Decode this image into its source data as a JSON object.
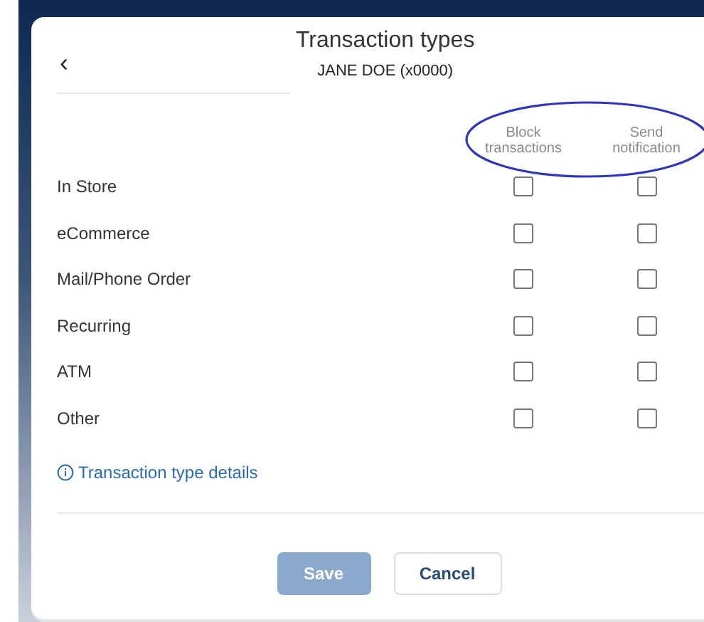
{
  "dialog": {
    "back": "‹",
    "title": "Transaction types",
    "subtitle": "JANE DOE (x0000)"
  },
  "columns": [
    "Block\ntransactions",
    "Send\nnotification"
  ],
  "annotations": [
    {
      "kind": "ellipse"
    }
  ],
  "rows": [
    {
      "label": "In Store",
      "block": false,
      "notify": false
    },
    {
      "label": "eCommerce",
      "block": false,
      "notify": false
    },
    {
      "label": "Mail/Phone Order",
      "block": false,
      "notify": false
    },
    {
      "label": "Recurring",
      "block": false,
      "notify": false
    },
    {
      "label": "ATM",
      "block": false,
      "notify": false
    },
    {
      "label": "Other",
      "block": false,
      "notify": false
    }
  ],
  "details_link": "Transaction type details",
  "buttons": [
    {
      "label": "Save",
      "kind": "primary",
      "disabled": true
    },
    {
      "label": "Cancel",
      "kind": "secondary",
      "disabled": false
    }
  ]
}
